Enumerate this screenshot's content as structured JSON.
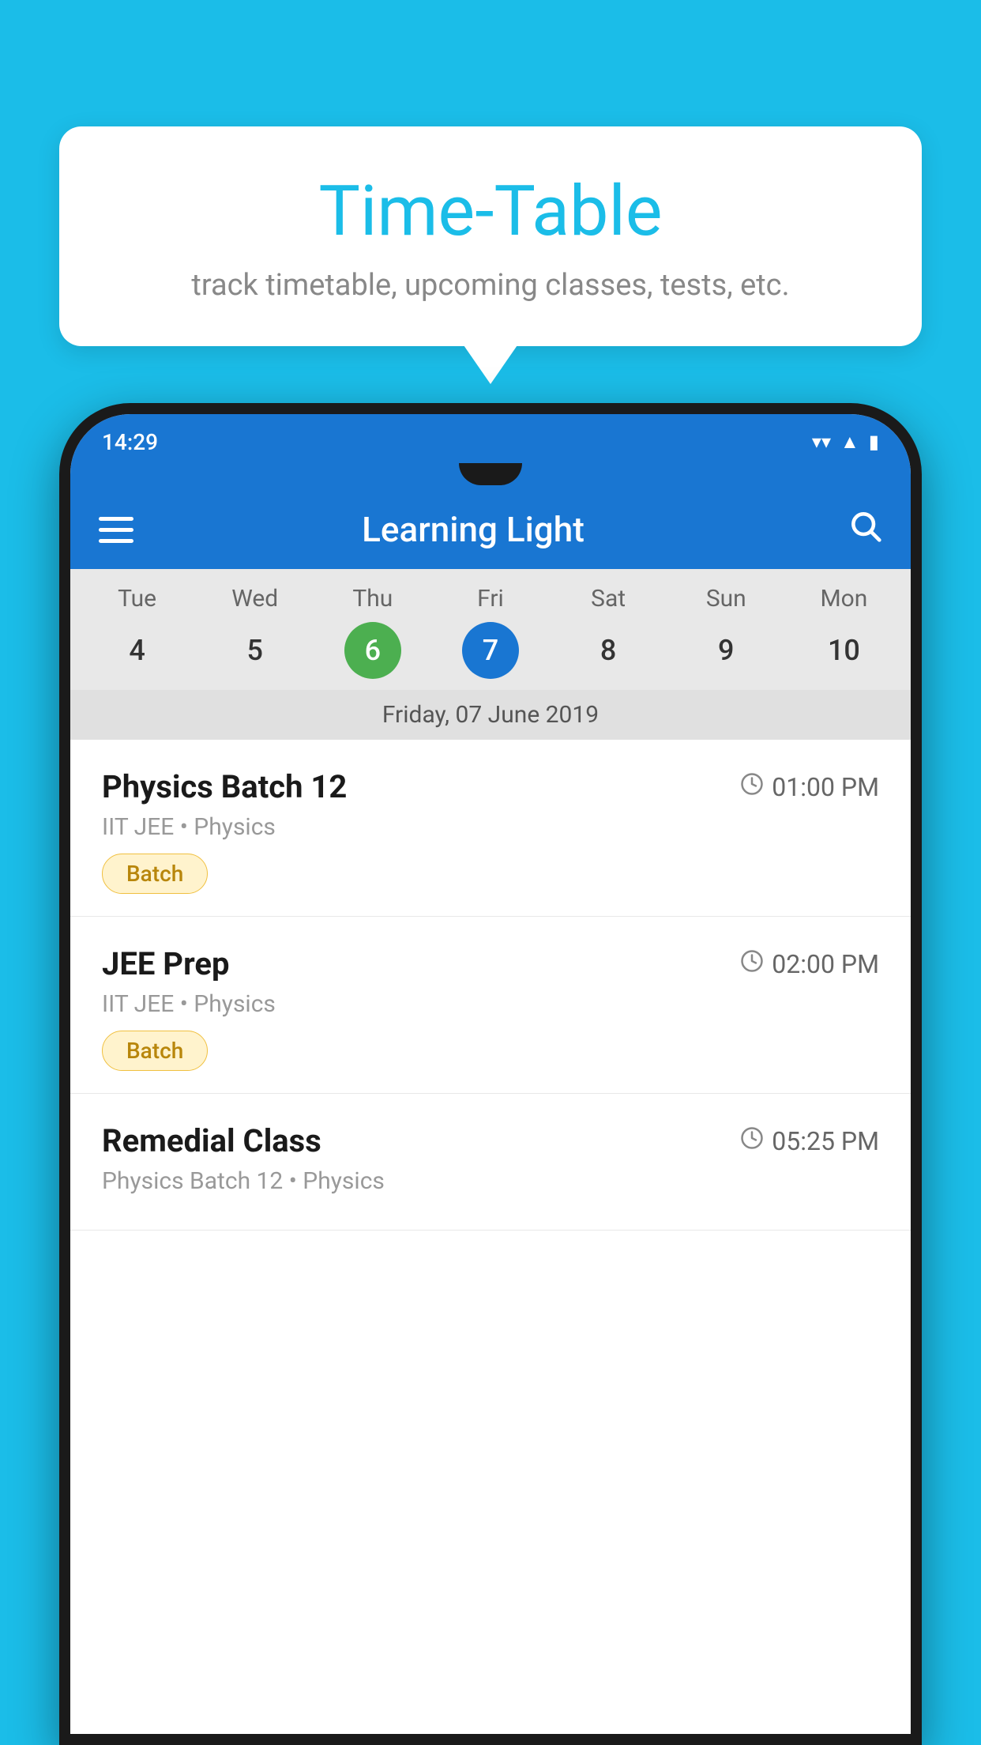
{
  "background_color": "#1BBDE8",
  "tooltip": {
    "title": "Time-Table",
    "subtitle": "track timetable, upcoming classes, tests, etc."
  },
  "phone": {
    "status_bar": {
      "time": "14:29"
    },
    "app_bar": {
      "title": "Learning Light"
    },
    "calendar": {
      "days": [
        "Tue",
        "Wed",
        "Thu",
        "Fri",
        "Sat",
        "Sun",
        "Mon"
      ],
      "dates": [
        {
          "num": "4",
          "state": "normal"
        },
        {
          "num": "5",
          "state": "normal"
        },
        {
          "num": "6",
          "state": "today"
        },
        {
          "num": "7",
          "state": "selected"
        },
        {
          "num": "8",
          "state": "normal"
        },
        {
          "num": "9",
          "state": "normal"
        },
        {
          "num": "10",
          "state": "normal"
        }
      ],
      "selected_date": "Friday, 07 June 2019"
    },
    "schedule": [
      {
        "title": "Physics Batch 12",
        "time": "01:00 PM",
        "subtitle": "IIT JEE • Physics",
        "badge": "Batch"
      },
      {
        "title": "JEE Prep",
        "time": "02:00 PM",
        "subtitle": "IIT JEE • Physics",
        "badge": "Batch"
      },
      {
        "title": "Remedial Class",
        "time": "05:25 PM",
        "subtitle": "Physics Batch 12 • Physics",
        "badge": null
      }
    ]
  }
}
